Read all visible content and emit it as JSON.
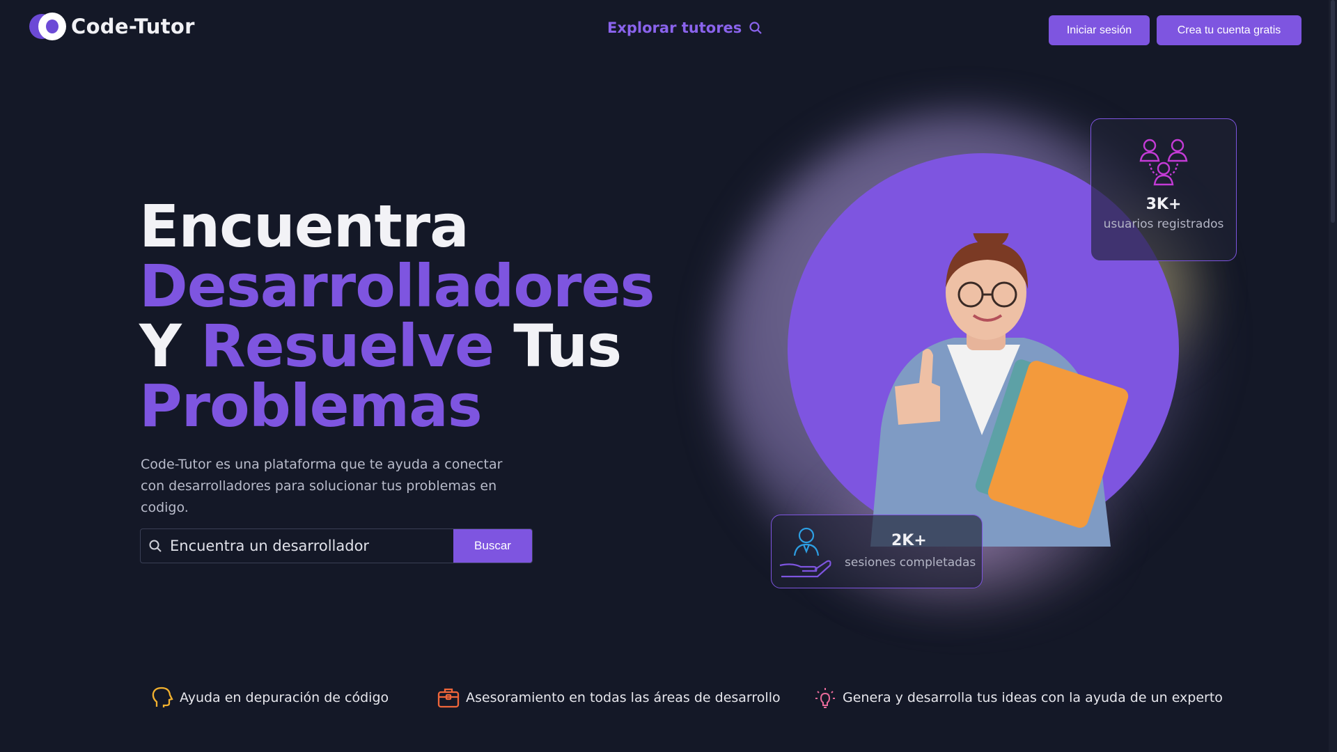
{
  "header": {
    "logo_text": "Code-Tutor",
    "explore_label": "Explorar tutores",
    "login_label": "Iniciar sesión",
    "signup_label": "Crea tu cuenta gratis"
  },
  "hero": {
    "line1": "Encuentra",
    "line2": "Desarrolladores",
    "line3_a": "Y",
    "line3_b": "Resuelve",
    "line3_c": "Tus",
    "line4": "Problemas",
    "description": "Code-Tutor es una plataforma que te ayuda a conectar con desarrolladores para solucionar tus problemas en codigo.",
    "search_placeholder": "Encuentra un desarrollador",
    "search_button": "Buscar"
  },
  "stats": {
    "users_value": "3K+",
    "users_label": "usuarios registrados",
    "sessions_value": "2K+",
    "sessions_label": "sesiones completadas"
  },
  "features": [
    {
      "icon": "head-icon",
      "label": "Ayuda en depuración de código"
    },
    {
      "icon": "briefcase-icon",
      "label": "Asesoramiento en todas las áreas de desarrollo"
    },
    {
      "icon": "lightbulb-icon",
      "label": "Genera y desarrolla tus ideas con la ayuda de un experto"
    }
  ],
  "colors": {
    "background": "#141827",
    "accent": "#7e55e0",
    "text": "#f2f2f6"
  }
}
